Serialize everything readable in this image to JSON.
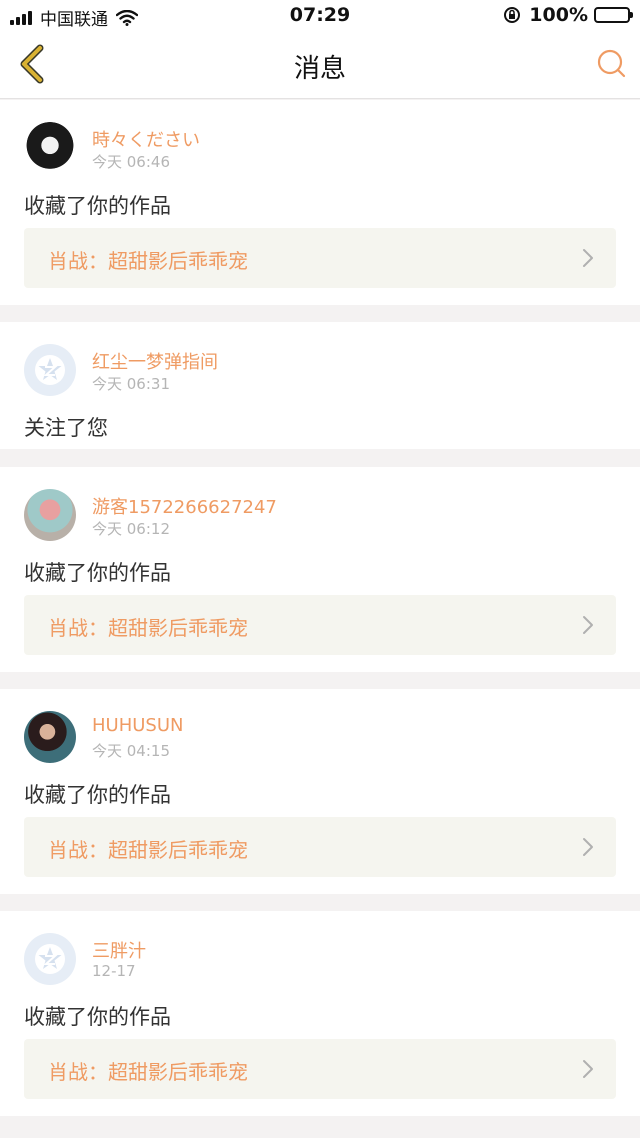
{
  "status_bar": {
    "carrier": "中国联通",
    "time": "07:29",
    "battery": "100%",
    "icons": [
      "signal-icon",
      "wifi-icon",
      "rotation-lock-icon",
      "battery-icon"
    ]
  },
  "nav": {
    "title": "消息",
    "back_icon": "chevron-left-icon",
    "search_icon": "search-icon"
  },
  "colors": {
    "accent": "#ef9b63",
    "back_arrow": "#d9b233",
    "timestamp": "#b5b5b5",
    "card_bg": "#ffffff",
    "page_bg": "#f4f2f2",
    "work_bg": "#f5f5ef"
  },
  "messages": [
    {
      "user": "時々ください",
      "time": "今天 06:46",
      "action": "收藏了你的作品",
      "work": "肖战：超甜影后乖乖宠",
      "avatar": "photo-avatar"
    },
    {
      "user": "红尘一梦弹指间",
      "time": "今天 06:31",
      "action": "关注了您",
      "avatar": "default-avatar-icon"
    },
    {
      "user": "游客1572266627247",
      "time": "今天 06:12",
      "action": "收藏了你的作品",
      "work": "肖战：超甜影后乖乖宠",
      "avatar": "photo-avatar"
    },
    {
      "user": "HUHUSUN",
      "time": "今天 04:15",
      "action": "收藏了你的作品",
      "work": "肖战：超甜影后乖乖宠",
      "avatar": "photo-avatar"
    },
    {
      "user": "三胖汁",
      "time": "12-17",
      "action": "收藏了你的作品",
      "work": "肖战：超甜影后乖乖宠",
      "avatar": "default-avatar-icon"
    }
  ]
}
